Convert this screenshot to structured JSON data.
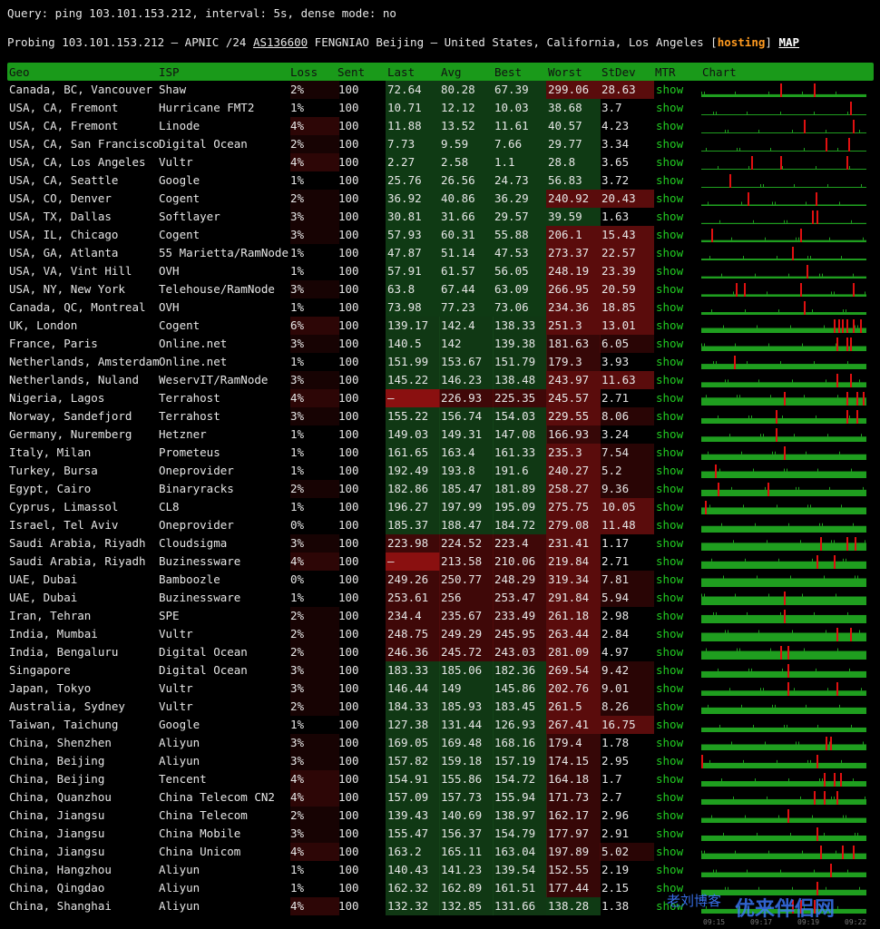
{
  "query": "Query: ping 103.101.153.212, interval: 5s, dense mode: no",
  "probe": {
    "prefix": "Probing 103.101.153.212 — APNIC /24 ",
    "asn": "AS136600",
    "middle": " FENGNIAO Beijing — United States, California, Los Angeles [",
    "hosting": "hosting",
    "close": "] ",
    "map": "MAP"
  },
  "headers": {
    "geo": "Geo",
    "isp": "ISP",
    "loss": "Loss",
    "sent": "Sent",
    "last": "Last",
    "avg": "Avg",
    "best": "Best",
    "worst": "Worst",
    "stdev": "StDev",
    "mtr": "MTR",
    "chart": "Chart"
  },
  "colors": {
    "header_green": "#1a9a1a",
    "good_green": "#0f3a14",
    "bad_red": "#5a0c0c",
    "link_green": "#22cc22",
    "chart_green": "#1f9e1f",
    "spike_red": "#e01010",
    "hosting_orange": "#ff9a1f"
  },
  "rows": [
    {
      "geo": "Canada, BC, Vancouver",
      "isp": "Shaw",
      "loss": "2%",
      "sent": "100",
      "last": "72.64",
      "avg": "80.28",
      "best": "67.39",
      "worst": "299.06",
      "stdev": "28.63",
      "mtr": "show",
      "bars": [
        0.05,
        0.9
      ],
      "spikes": [
        0.48,
        0.68
      ]
    },
    {
      "geo": "USA, CA, Fremont",
      "isp": "Hurricane FMT2",
      "loss": "1%",
      "sent": "100",
      "last": "10.71",
      "avg": "12.12",
      "best": "10.03",
      "worst": "38.68",
      "stdev": "3.7",
      "mtr": "show",
      "bars": [
        0.05,
        0.2
      ],
      "spikes": [
        0.9
      ]
    },
    {
      "geo": "USA, CA, Fremont",
      "isp": "Linode",
      "loss": "4%",
      "sent": "100",
      "last": "11.88",
      "avg": "13.52",
      "best": "11.61",
      "worst": "40.57",
      "stdev": "4.23",
      "mtr": "show",
      "bars": [
        0.05,
        0.2
      ],
      "spikes": [
        0.62,
        0.92
      ]
    },
    {
      "geo": "USA, CA, San Francisco",
      "isp": "Digital Ocean",
      "loss": "2%",
      "sent": "100",
      "last": "7.73",
      "avg": "9.59",
      "best": "7.66",
      "worst": "29.77",
      "stdev": "3.34",
      "mtr": "show",
      "bars": [
        0.05,
        0.2
      ],
      "spikes": [
        0.75,
        0.89
      ]
    },
    {
      "geo": "USA, CA, Los Angeles",
      "isp": "Vultr",
      "loss": "4%",
      "sent": "100",
      "last": "2.27",
      "avg": "2.58",
      "best": "1.1",
      "worst": "28.8",
      "stdev": "3.65",
      "mtr": "show",
      "bars": [
        0.05,
        0.2
      ],
      "spikes": [
        0.3,
        0.48,
        0.88
      ]
    },
    {
      "geo": "USA, CA, Seattle",
      "isp": "Google",
      "loss": "1%",
      "sent": "100",
      "last": "25.76",
      "avg": "26.56",
      "best": "24.73",
      "worst": "56.83",
      "stdev": "3.72",
      "mtr": "show",
      "bars": [
        0.05,
        0.3
      ],
      "spikes": [
        0.17
      ]
    },
    {
      "geo": "USA, CO, Denver",
      "isp": "Cogent",
      "loss": "2%",
      "sent": "100",
      "last": "36.92",
      "avg": "40.86",
      "best": "36.29",
      "worst": "240.92",
      "stdev": "20.43",
      "mtr": "show",
      "bars": [
        0.1,
        0.4
      ],
      "spikes": [
        0.28,
        0.69
      ]
    },
    {
      "geo": "USA, TX, Dallas",
      "isp": "Softlayer",
      "loss": "3%",
      "sent": "100",
      "last": "30.81",
      "avg": "31.66",
      "best": "29.57",
      "worst": "39.59",
      "stdev": "1.63",
      "mtr": "show",
      "bars": [
        0.1,
        0.35
      ],
      "spikes": [
        0.67,
        0.7
      ]
    },
    {
      "geo": "USA, IL, Chicago",
      "isp": "Cogent",
      "loss": "3%",
      "sent": "100",
      "last": "57.93",
      "avg": "60.31",
      "best": "55.88",
      "worst": "206.1",
      "stdev": "15.43",
      "mtr": "show",
      "bars": [
        0.15,
        0.35
      ],
      "spikes": [
        0.06,
        0.6
      ]
    },
    {
      "geo": "USA, GA, Atlanta",
      "isp": "55 Marietta/RamNode",
      "loss": "1%",
      "sent": "100",
      "last": "47.87",
      "avg": "51.14",
      "best": "47.53",
      "worst": "273.37",
      "stdev": "22.57",
      "mtr": "show",
      "bars": [
        0.1,
        0.35
      ],
      "spikes": [
        0.55
      ]
    },
    {
      "geo": "USA, VA, Vint Hill",
      "isp": "OVH",
      "loss": "1%",
      "sent": "100",
      "last": "57.91",
      "avg": "61.57",
      "best": "56.05",
      "worst": "248.19",
      "stdev": "23.39",
      "mtr": "show",
      "bars": [
        0.15,
        0.5
      ],
      "spikes": [
        0.64
      ]
    },
    {
      "geo": "USA, NY, New York",
      "isp": "Telehouse/RamNode",
      "loss": "3%",
      "sent": "100",
      "last": "63.8",
      "avg": "67.44",
      "best": "63.09",
      "worst": "266.95",
      "stdev": "20.59",
      "mtr": "show",
      "bars": [
        0.15,
        0.5
      ],
      "spikes": [
        0.21,
        0.26,
        0.6,
        0.92
      ]
    },
    {
      "geo": "Canada, QC, Montreal",
      "isp": "OVH",
      "loss": "1%",
      "sent": "100",
      "last": "73.98",
      "avg": "77.23",
      "best": "73.06",
      "worst": "234.36",
      "stdev": "18.85",
      "mtr": "show",
      "bars": [
        0.15,
        0.45
      ],
      "spikes": [
        0.62
      ]
    },
    {
      "geo": "UK, London",
      "isp": "Cogent",
      "loss": "6%",
      "sent": "100",
      "last": "139.17",
      "avg": "142.4",
      "best": "138.33",
      "worst": "251.3",
      "stdev": "13.01",
      "mtr": "show",
      "bars": [
        0.5,
        0.75
      ],
      "spikes": [
        0.8,
        0.83,
        0.85,
        0.88,
        0.92,
        0.96
      ]
    },
    {
      "geo": "France, Paris",
      "isp": "Online.net",
      "loss": "3%",
      "sent": "100",
      "last": "140.5",
      "avg": "142",
      "best": "139.38",
      "worst": "181.63",
      "stdev": "6.05",
      "mtr": "show",
      "bars": [
        0.5,
        0.8
      ],
      "spikes": [
        0.82,
        0.88,
        0.9
      ]
    },
    {
      "geo": "Netherlands, Amsterdam",
      "isp": "Online.net",
      "loss": "1%",
      "sent": "100",
      "last": "151.99",
      "avg": "153.67",
      "best": "151.79",
      "worst": "179.3",
      "stdev": "3.93",
      "mtr": "show",
      "bars": [
        0.55,
        0.8
      ],
      "spikes": [
        0.2
      ]
    },
    {
      "geo": "Netherlands, Nuland",
      "isp": "WeservIT/RamNode",
      "loss": "3%",
      "sent": "100",
      "last": "145.22",
      "avg": "146.23",
      "best": "138.48",
      "worst": "243.97",
      "stdev": "11.63",
      "mtr": "show",
      "bars": [
        0.5,
        0.8
      ],
      "spikes": [
        0.82,
        0.9
      ]
    },
    {
      "geo": "Nigeria, Lagos",
      "isp": "Terrahost",
      "loss": "4%",
      "sent": "100",
      "last": "—",
      "avg": "226.93",
      "best": "225.35",
      "worst": "245.57",
      "stdev": "2.71",
      "mtr": "show",
      "bars": [
        0.7,
        0.95
      ],
      "spikes": [
        0.5,
        0.88,
        0.94,
        0.98
      ]
    },
    {
      "geo": "Norway, Sandefjord",
      "isp": "Terrahost",
      "loss": "3%",
      "sent": "100",
      "last": "155.22",
      "avg": "156.74",
      "best": "154.03",
      "worst": "229.55",
      "stdev": "8.06",
      "mtr": "show",
      "bars": [
        0.55,
        0.85
      ],
      "spikes": [
        0.45,
        0.88,
        0.94
      ]
    },
    {
      "geo": "Germany, Nuremberg",
      "isp": "Hetzner",
      "loss": "1%",
      "sent": "100",
      "last": "149.03",
      "avg": "149.31",
      "best": "147.08",
      "worst": "166.93",
      "stdev": "3.24",
      "mtr": "show",
      "bars": [
        0.55,
        0.8
      ],
      "spikes": [
        0.45
      ]
    },
    {
      "geo": "Italy, Milan",
      "isp": "Prometeus",
      "loss": "1%",
      "sent": "100",
      "last": "161.65",
      "avg": "163.4",
      "best": "161.33",
      "worst": "235.3",
      "stdev": "7.54",
      "mtr": "show",
      "bars": [
        0.6,
        0.85
      ],
      "spikes": [
        0.5
      ]
    },
    {
      "geo": "Turkey, Bursa",
      "isp": "Oneprovider",
      "loss": "1%",
      "sent": "100",
      "last": "192.49",
      "avg": "193.8",
      "best": "191.6",
      "worst": "240.27",
      "stdev": "5.2",
      "mtr": "show",
      "bars": [
        0.7,
        0.9
      ],
      "spikes": [
        0.08
      ]
    },
    {
      "geo": "Egypt, Cairo",
      "isp": "Binaryracks",
      "loss": "2%",
      "sent": "100",
      "last": "182.86",
      "avg": "185.47",
      "best": "181.89",
      "worst": "258.27",
      "stdev": "9.36",
      "mtr": "show",
      "bars": [
        0.65,
        0.9
      ],
      "spikes": [
        0.1,
        0.4
      ]
    },
    {
      "geo": "Cyprus, Limassol",
      "isp": "CL8",
      "loss": "1%",
      "sent": "100",
      "last": "196.27",
      "avg": "197.99",
      "best": "195.09",
      "worst": "275.75",
      "stdev": "10.05",
      "mtr": "show",
      "bars": [
        0.7,
        0.9
      ],
      "spikes": [
        0.02
      ]
    },
    {
      "geo": "Israel, Tel Aviv",
      "isp": "Oneprovider",
      "loss": "0%",
      "sent": "100",
      "last": "185.37",
      "avg": "188.47",
      "best": "184.72",
      "worst": "279.08",
      "stdev": "11.48",
      "mtr": "show",
      "bars": [
        0.65,
        0.9
      ],
      "spikes": []
    },
    {
      "geo": "Saudi Arabia, Riyadh",
      "isp": "Cloudsigma",
      "loss": "3%",
      "sent": "100",
      "last": "223.98",
      "avg": "224.52",
      "best": "223.4",
      "worst": "231.41",
      "stdev": "1.17",
      "mtr": "show",
      "bars": [
        0.8,
        0.9
      ],
      "spikes": [
        0.72,
        0.88,
        0.93
      ]
    },
    {
      "geo": "Saudi Arabia, Riyadh",
      "isp": "Buzinessware",
      "loss": "4%",
      "sent": "100",
      "last": "—",
      "avg": "213.58",
      "best": "210.06",
      "worst": "219.84",
      "stdev": "2.71",
      "mtr": "show",
      "bars": [
        0.75,
        0.9
      ],
      "spikes": [
        0.7,
        0.8
      ]
    },
    {
      "geo": "UAE, Dubai",
      "isp": "Bamboozle",
      "loss": "0%",
      "sent": "100",
      "last": "249.26",
      "avg": "250.77",
      "best": "248.29",
      "worst": "319.34",
      "stdev": "7.81",
      "mtr": "show",
      "bars": [
        0.85,
        0.95
      ],
      "spikes": []
    },
    {
      "geo": "UAE, Dubai",
      "isp": "Buzinessware",
      "loss": "1%",
      "sent": "100",
      "last": "253.61",
      "avg": "256",
      "best": "253.47",
      "worst": "291.84",
      "stdev": "5.94",
      "mtr": "show",
      "bars": [
        0.85,
        0.95
      ],
      "spikes": [
        0.5
      ]
    },
    {
      "geo": "Iran, Tehran",
      "isp": "SPE",
      "loss": "2%",
      "sent": "100",
      "last": "234.4",
      "avg": "235.67",
      "best": "233.49",
      "worst": "261.18",
      "stdev": "2.98",
      "mtr": "show",
      "bars": [
        0.8,
        0.9
      ],
      "spikes": [
        0.5
      ]
    },
    {
      "geo": "India, Mumbai",
      "isp": "Vultr",
      "loss": "2%",
      "sent": "100",
      "last": "248.75",
      "avg": "249.29",
      "best": "245.95",
      "worst": "263.44",
      "stdev": "2.84",
      "mtr": "show",
      "bars": [
        0.85,
        0.9
      ],
      "spikes": [
        0.82,
        0.9
      ]
    },
    {
      "geo": "India, Bengaluru",
      "isp": "Digital Ocean",
      "loss": "2%",
      "sent": "100",
      "last": "246.36",
      "avg": "245.72",
      "best": "243.03",
      "worst": "281.09",
      "stdev": "4.97",
      "mtr": "show",
      "bars": [
        0.85,
        0.9
      ],
      "spikes": [
        0.48,
        0.52
      ]
    },
    {
      "geo": "Singapore",
      "isp": "Digital Ocean",
      "loss": "3%",
      "sent": "100",
      "last": "183.33",
      "avg": "185.06",
      "best": "182.36",
      "worst": "269.54",
      "stdev": "9.42",
      "mtr": "show",
      "bars": [
        0.65,
        0.9
      ],
      "spikes": [
        0.52
      ]
    },
    {
      "geo": "Japan, Tokyo",
      "isp": "Vultr",
      "loss": "3%",
      "sent": "100",
      "last": "146.44",
      "avg": "149",
      "best": "145.86",
      "worst": "202.76",
      "stdev": "9.01",
      "mtr": "show",
      "bars": [
        0.55,
        0.8
      ],
      "spikes": [
        0.52,
        0.82
      ]
    },
    {
      "geo": "Australia, Sydney",
      "isp": "Vultr",
      "loss": "2%",
      "sent": "100",
      "last": "184.33",
      "avg": "185.93",
      "best": "183.45",
      "worst": "261.5",
      "stdev": "8.26",
      "mtr": "show",
      "bars": [
        0.65,
        0.9
      ],
      "spikes": []
    },
    {
      "geo": "Taiwan, Taichung",
      "isp": "Google",
      "loss": "1%",
      "sent": "100",
      "last": "127.38",
      "avg": "131.44",
      "best": "126.93",
      "worst": "267.41",
      "stdev": "16.75",
      "mtr": "show",
      "bars": [
        0.45,
        0.75
      ],
      "spikes": []
    },
    {
      "geo": "China, Shenzhen",
      "isp": "Aliyun",
      "loss": "3%",
      "sent": "100",
      "last": "169.05",
      "avg": "169.48",
      "best": "168.16",
      "worst": "179.4",
      "stdev": "1.78",
      "mtr": "show",
      "bars": [
        0.6,
        0.85
      ],
      "spikes": [
        0.75,
        0.78
      ]
    },
    {
      "geo": "China, Beijing",
      "isp": "Aliyun",
      "loss": "3%",
      "sent": "100",
      "last": "157.82",
      "avg": "159.18",
      "best": "157.19",
      "worst": "174.15",
      "stdev": "2.95",
      "mtr": "show",
      "bars": [
        0.55,
        0.8
      ],
      "spikes": [
        0.0,
        0.7
      ]
    },
    {
      "geo": "China, Beijing",
      "isp": "Tencent",
      "loss": "4%",
      "sent": "100",
      "last": "154.91",
      "avg": "155.86",
      "best": "154.72",
      "worst": "164.18",
      "stdev": "1.7",
      "mtr": "show",
      "bars": [
        0.55,
        0.8
      ],
      "spikes": [
        0.74,
        0.8,
        0.84
      ]
    },
    {
      "geo": "China, Quanzhou",
      "isp": "China Telecom CN2",
      "loss": "4%",
      "sent": "100",
      "last": "157.09",
      "avg": "157.73",
      "best": "155.94",
      "worst": "171.73",
      "stdev": "2.7",
      "mtr": "show",
      "bars": [
        0.55,
        0.8
      ],
      "spikes": [
        0.68,
        0.74,
        0.82
      ]
    },
    {
      "geo": "China, Jiangsu",
      "isp": "China Telecom",
      "loss": "2%",
      "sent": "100",
      "last": "139.43",
      "avg": "140.69",
      "best": "138.97",
      "worst": "162.17",
      "stdev": "2.96",
      "mtr": "show",
      "bars": [
        0.5,
        0.75
      ],
      "spikes": [
        0.52
      ]
    },
    {
      "geo": "China, Jiangsu",
      "isp": "China Mobile",
      "loss": "3%",
      "sent": "100",
      "last": "155.47",
      "avg": "156.37",
      "best": "154.79",
      "worst": "177.97",
      "stdev": "2.91",
      "mtr": "show",
      "bars": [
        0.55,
        0.8
      ],
      "spikes": [
        0.7
      ]
    },
    {
      "geo": "China, Jiangsu",
      "isp": "China Unicom",
      "loss": "4%",
      "sent": "100",
      "last": "163.2",
      "avg": "165.11",
      "best": "163.04",
      "worst": "197.89",
      "stdev": "5.02",
      "mtr": "show",
      "bars": [
        0.6,
        0.85
      ],
      "spikes": [
        0.72,
        0.85,
        0.92
      ]
    },
    {
      "geo": "China, Hangzhou",
      "isp": "Aliyun",
      "loss": "1%",
      "sent": "100",
      "last": "140.43",
      "avg": "141.23",
      "best": "139.54",
      "worst": "152.55",
      "stdev": "2.19",
      "mtr": "show",
      "bars": [
        0.5,
        0.75
      ],
      "spikes": [
        0.78
      ]
    },
    {
      "geo": "China, Qingdao",
      "isp": "Aliyun",
      "loss": "1%",
      "sent": "100",
      "last": "162.32",
      "avg": "162.89",
      "best": "161.51",
      "worst": "177.44",
      "stdev": "2.15",
      "mtr": "show",
      "bars": [
        0.6,
        0.85
      ],
      "spikes": [
        0.7
      ]
    },
    {
      "geo": "China, Shanghai",
      "isp": "Aliyun",
      "loss": "4%",
      "sent": "100",
      "last": "132.32",
      "avg": "132.85",
      "best": "131.66",
      "worst": "138.28",
      "stdev": "1.38",
      "mtr": "show",
      "bars": [
        0.45,
        0.75
      ],
      "spikes": [
        0.55,
        0.6,
        0.68
      ]
    }
  ],
  "watermark": "老刘博客",
  "watermark2": "优来伴侣网",
  "time_ticks": [
    "09:15",
    "09:17",
    "09:19",
    "09:22"
  ]
}
